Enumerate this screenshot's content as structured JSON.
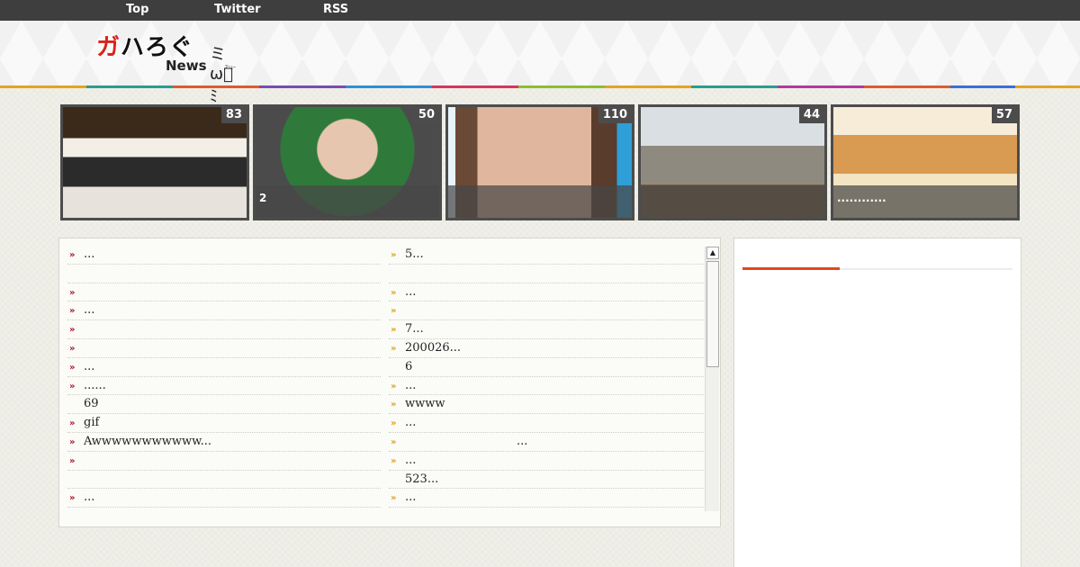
{
  "nav": {
    "items": [
      "Top",
      "Twitter",
      "RSS"
    ]
  },
  "logo": {
    "jp_red": "ガ",
    "jp_black": "ハろぐ",
    "news": "News",
    "cat": "ミω゚ﾐ",
    "cat_sub": "ｱﾆｭｰ"
  },
  "thumbnails": [
    {
      "count": "83",
      "caption": ""
    },
    {
      "count": "50",
      "caption": "2"
    },
    {
      "count": "110",
      "caption": ""
    },
    {
      "count": "44",
      "caption": ""
    },
    {
      "count": "57",
      "caption": "............"
    }
  ],
  "list": {
    "left": [
      {
        "text": "...",
        "icon": true
      },
      {
        "text": "",
        "icon": false
      },
      {
        "text": "",
        "icon": true
      },
      {
        "text": "...",
        "icon": true
      },
      {
        "text": "",
        "icon": true
      },
      {
        "text": "",
        "icon": true
      },
      {
        "text": "...",
        "icon": true
      },
      {
        "text": "......",
        "icon": true
      },
      {
        "text": "69",
        "icon": false
      },
      {
        "text": "gif",
        "icon": true
      },
      {
        "text": "Awwwwwwwwwww...",
        "icon": true
      },
      {
        "text": "",
        "icon": true
      },
      {
        "text": "",
        "icon": false
      },
      {
        "text": "...",
        "icon": true
      }
    ],
    "right": [
      {
        "text": "5...",
        "icon": true
      },
      {
        "text": "",
        "icon": false
      },
      {
        "text": "...",
        "icon": true
      },
      {
        "text": "",
        "icon": true
      },
      {
        "text": "7...",
        "icon": true
      },
      {
        "text": "200026...",
        "icon": true
      },
      {
        "text": "6",
        "icon": false
      },
      {
        "text": "...",
        "icon": true
      },
      {
        "text": "wwww",
        "icon": true
      },
      {
        "text": "...",
        "icon": true
      },
      {
        "text": "                              ...",
        "icon": true
      },
      {
        "text": "...",
        "icon": true
      },
      {
        "text": "523...",
        "icon": false
      },
      {
        "text": "...",
        "icon": true
      }
    ]
  },
  "scrollbar": {
    "up_arrow": "▲"
  },
  "colors": {
    "nav_bg": "#3e3e3e",
    "accent": "#e0481f",
    "left_marker": "#b0132b",
    "right_marker": "#d9a414"
  },
  "icons": {
    "list_marker": "double-chevron-right-icon"
  }
}
